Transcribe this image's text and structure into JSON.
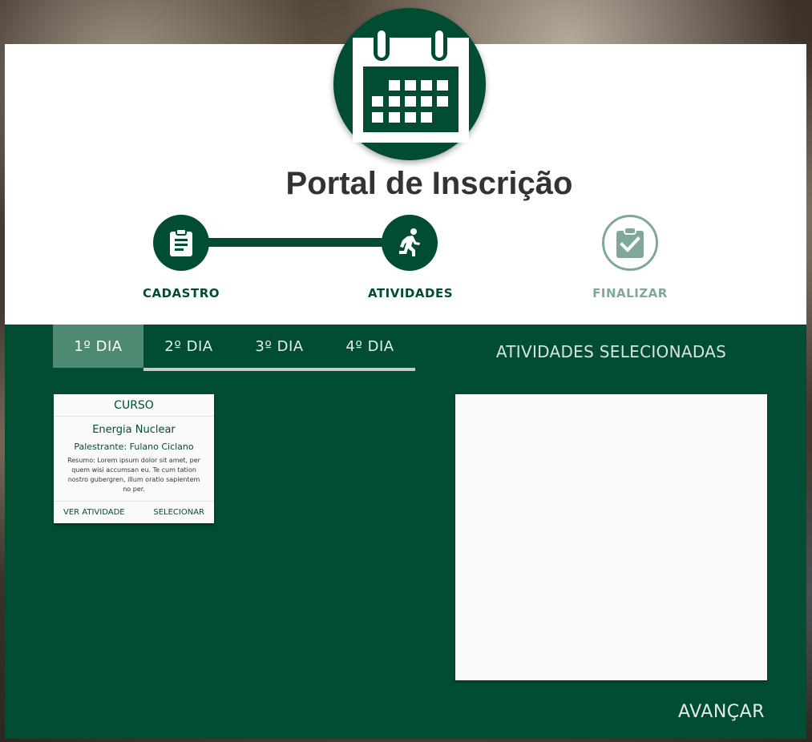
{
  "header": {
    "logo_icon": "calendar-icon",
    "title": "Portal de Inscrição"
  },
  "stepper": {
    "steps": [
      {
        "label": "CADASTRO",
        "icon": "clipboard-icon",
        "state": "done"
      },
      {
        "label": "ATIVIDADES",
        "icon": "running-person-icon",
        "state": "current"
      },
      {
        "label": "FINALIZAR",
        "icon": "clipboard-check-icon",
        "state": "pending"
      }
    ]
  },
  "tabs": {
    "items": [
      {
        "label": "1º DIA",
        "active": true
      },
      {
        "label": "2º DIA",
        "active": false
      },
      {
        "label": "3º DIA",
        "active": false
      },
      {
        "label": "4º DIA",
        "active": false
      }
    ]
  },
  "activities": [
    {
      "type": "CURSO",
      "title": "Energia Nuclear",
      "speaker": "Palestrante: Fulano Ciclano",
      "summary": "Resumo: Lorem ipsum dolor sit amet, per quem wisi accumsan eu. Te cum tation nostro gubergren, illum oratio sapientem no per.",
      "view_label": "VER ATIVIDADE",
      "select_label": "SELECIONAR"
    }
  ],
  "selected": {
    "title": "ATIVIDADES SELECIONADAS"
  },
  "footer": {
    "advance_label": "AVANÇAR"
  },
  "colors": {
    "primary": "#004d33",
    "tab_active": "#4e8a72",
    "pending": "#7fa899",
    "title_text": "#333333"
  }
}
